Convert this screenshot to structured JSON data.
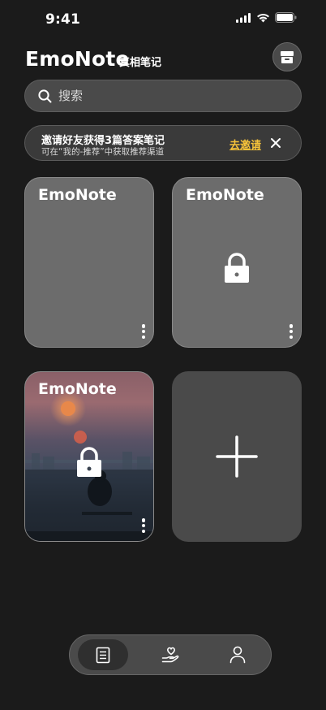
{
  "status_bar": {
    "time": "9:41"
  },
  "header": {
    "title": "EmoNote",
    "subtitle": "真相笔记"
  },
  "search": {
    "placeholder": "搜索"
  },
  "invite_banner": {
    "title": "邀请好友获得3篇答案笔记",
    "subtitle": "可在“我的-推荐”中获取推荐渠道",
    "link_label": "去邀请"
  },
  "notebooks": [
    {
      "title": "EmoNote",
      "locked": false
    },
    {
      "title": "EmoNote",
      "locked": true
    },
    {
      "title": "EmoNote",
      "locked": true
    }
  ],
  "icons": {
    "archive": "archive-box-icon",
    "search": "search-icon",
    "close": "close-icon",
    "lock": "lock-icon",
    "add": "plus-icon",
    "nav": [
      "notes-icon",
      "heart-hand-icon",
      "person-icon"
    ]
  },
  "colors": {
    "accent": "#f5c23a",
    "background": "#1b1b1b"
  }
}
